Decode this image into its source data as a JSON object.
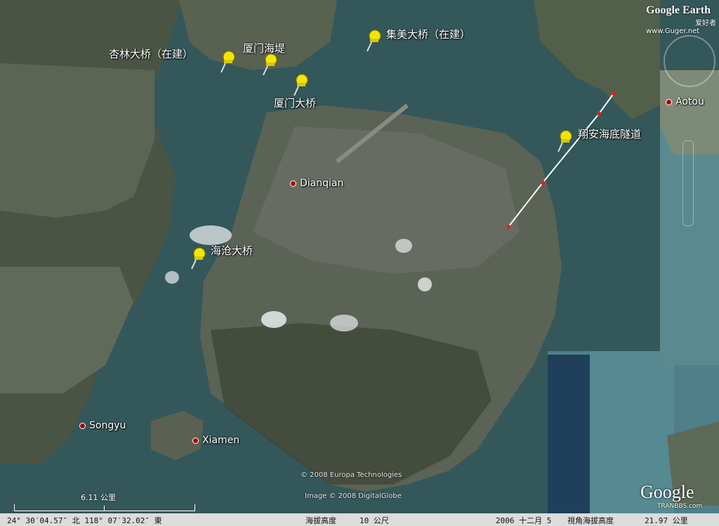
{
  "pins": [
    {
      "id": "xinglin",
      "label": "杏林大桥（在建）"
    },
    {
      "id": "haidi",
      "label": "厦门海堤"
    },
    {
      "id": "xiamen_bridge",
      "label": "厦门大桥"
    },
    {
      "id": "jimei",
      "label": "集美大桥（在建）"
    },
    {
      "id": "xiangan",
      "label": "翔安海底隧道"
    },
    {
      "id": "haicang",
      "label": "海沧大桥"
    }
  ],
  "cities": [
    {
      "id": "aotou",
      "label": "Aotou"
    },
    {
      "id": "dianqian",
      "label": "Dianqian"
    },
    {
      "id": "songyu",
      "label": "Songyu"
    },
    {
      "id": "xiamen",
      "label": "Xiamen"
    }
  ],
  "credits": {
    "europa": "© 2008 Europa Technologies",
    "digitalglobe": "Image © 2008 DigitalGlobe"
  },
  "scale": {
    "label": "6.11 公里"
  },
  "logo": {
    "top_line1": "Google Earth",
    "top_line2": "爱好者",
    "top_line3": "www.Guger.net",
    "bottom": "Google",
    "tranbbs": "TRANBBS.com"
  },
  "status": {
    "coords": "24° 30′04.57″ 北  118° 07′32.02″ 東",
    "elev_label": "海拔高度",
    "elev_value": "10 公尺",
    "date": "2006 十二月 5",
    "eye_label": "視角海拔高度",
    "eye_value": "21.97 公里"
  },
  "colors": {
    "water": "#3a5a5c",
    "land": "#55604a",
    "pin": "#f2e600",
    "route": "#ffffff",
    "city_dot": "#aa0000"
  }
}
